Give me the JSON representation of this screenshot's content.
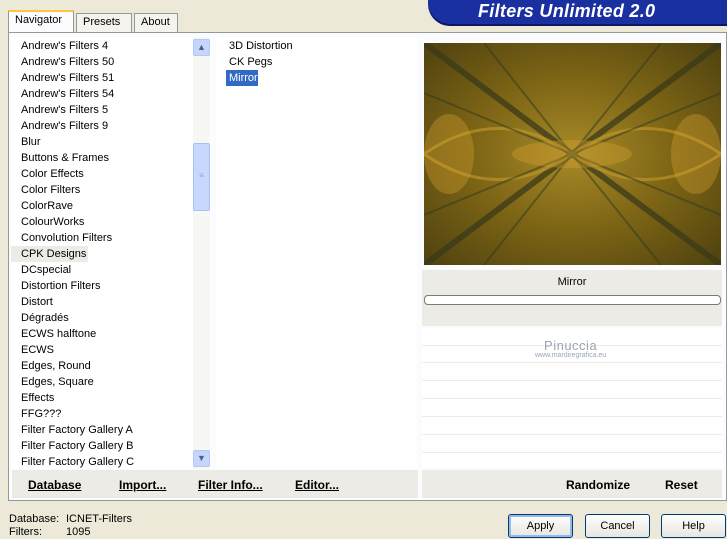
{
  "tabs": [
    {
      "label": "Navigator"
    },
    {
      "label": "Presets"
    },
    {
      "label": "About"
    }
  ],
  "banner": {
    "title": "Filters Unlimited 2.0"
  },
  "categories": [
    "Andrew's Filters 4",
    "Andrew's Filters 50",
    "Andrew's Filters 51",
    "Andrew's Filters 54",
    "Andrew's Filters 5",
    "Andrew's Filters 9",
    "Blur",
    "Buttons & Frames",
    "Color Effects",
    "Color Filters",
    "ColorRave",
    "ColourWorks",
    "Convolution Filters",
    "CPK Designs",
    "DCspecial",
    "Distortion Filters",
    "Distort",
    "Dégradés",
    "ECWS halftone",
    "ECWS",
    "Edges, Round",
    "Edges, Square",
    "Effects",
    "FFG???",
    "Filter Factory Gallery A",
    "Filter Factory Gallery B",
    "Filter Factory Gallery C"
  ],
  "selected_category": "CPK Designs",
  "filters": [
    "3D Distortion",
    "CK Pegs",
    "Mirror"
  ],
  "selected_filter": "Mirror",
  "preview": {
    "filter_name": "Mirror"
  },
  "watermark": {
    "name": "Pinuccia",
    "url": "www.mardiregrafica.eu"
  },
  "toolbar_left": {
    "database": "Database",
    "import": "Import...",
    "filter_info": "Filter Info...",
    "editor": "Editor..."
  },
  "toolbar_right": {
    "randomize": "Randomize",
    "reset": "Reset"
  },
  "status": {
    "database_label": "Database:",
    "database_value": "ICNET-Filters",
    "filters_label": "Filters:",
    "filters_value": "1095"
  },
  "buttons": {
    "apply": "Apply",
    "cancel": "Cancel",
    "help": "Help"
  },
  "colors": {
    "banner": "#1a2fa0",
    "selection": "#316ac5",
    "background": "#ece9d8"
  }
}
